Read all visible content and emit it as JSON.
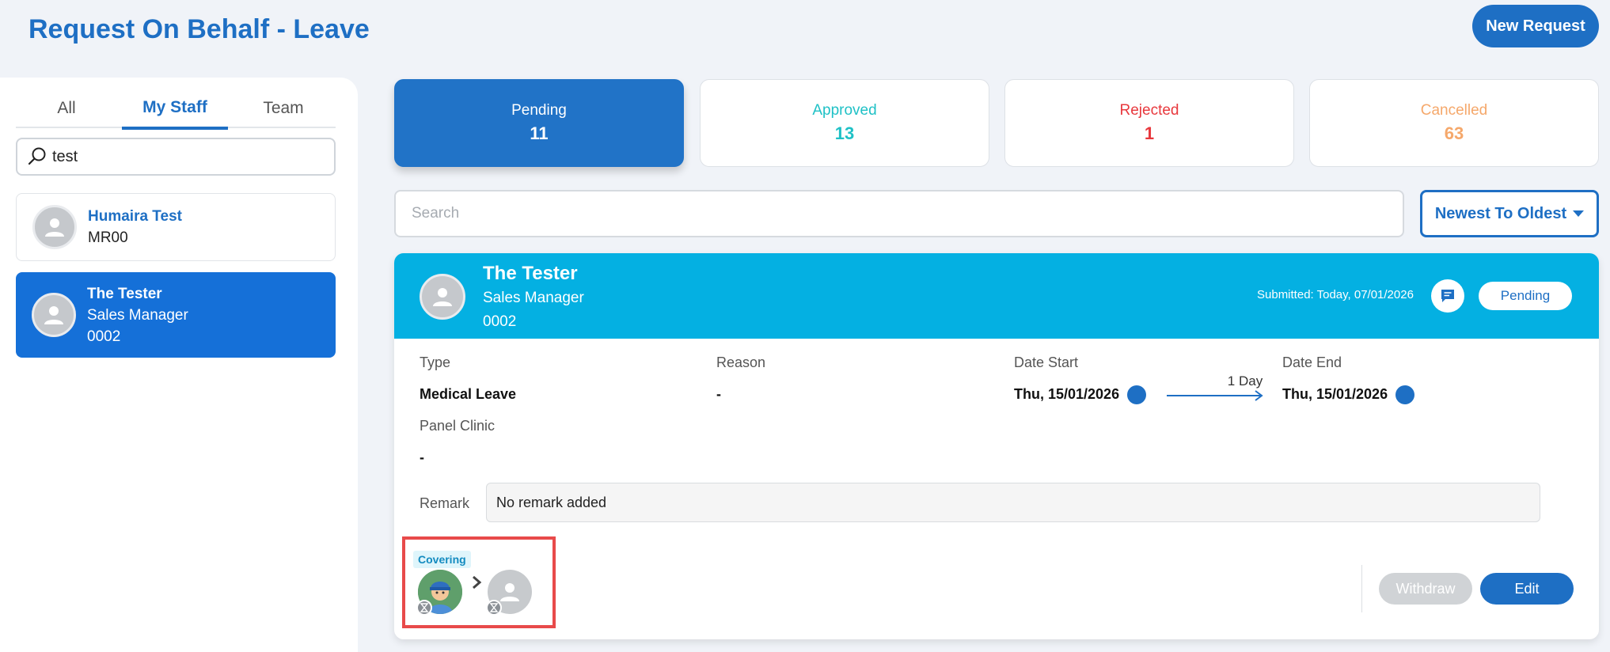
{
  "page": {
    "title": "Request On Behalf - Leave",
    "new_request_label": "New Request"
  },
  "left": {
    "tabs": [
      {
        "label": "All",
        "active": false
      },
      {
        "label": "My Staff",
        "active": true
      },
      {
        "label": "Team",
        "active": false
      }
    ],
    "search_value": "test",
    "staff": [
      {
        "name": "Humaira Test",
        "code": "MR00",
        "selected": false
      },
      {
        "name": "The Tester",
        "position": "Sales Manager",
        "code": "0002",
        "selected": true
      }
    ]
  },
  "status": {
    "pending": {
      "label": "Pending",
      "count": "11"
    },
    "approved": {
      "label": "Approved",
      "count": "13"
    },
    "rejected": {
      "label": "Rejected",
      "count": "1"
    },
    "cancelled": {
      "label": "Cancelled",
      "count": "63"
    }
  },
  "search_placeholder": "Search",
  "sort_label": "Newest To Oldest",
  "request": {
    "name": "The Tester",
    "position": "Sales Manager",
    "code": "0002",
    "submitted": "Submitted: Today, 07/01/2026",
    "status_label": "Pending",
    "type_label": "Type",
    "type_value": "Medical Leave",
    "reason_label": "Reason",
    "reason_value": "-",
    "date_start_label": "Date Start",
    "date_start_value": "Thu, 15/01/2026",
    "duration": "1 Day",
    "date_end_label": "Date End",
    "date_end_value": "Thu, 15/01/2026",
    "panel_clinic_label": "Panel Clinic",
    "panel_clinic_value": "-",
    "remark_label": "Remark",
    "remark_value": "No remark added",
    "covering_label": "Covering",
    "withdraw_label": "Withdraw",
    "edit_label": "Edit"
  },
  "colors": {
    "brand": "#1e6fc4",
    "header": "#04b0e2",
    "approved": "#1fc1c6",
    "rejected": "#e8383d",
    "cancelled": "#f5a86b",
    "highlight": "#e84a4a"
  },
  "icons": [
    "search-icon",
    "avatar-placeholder-icon",
    "chat-icon",
    "arrow-right-icon",
    "chevron-right-icon",
    "hourglass-icon",
    "caret-down-icon"
  ]
}
